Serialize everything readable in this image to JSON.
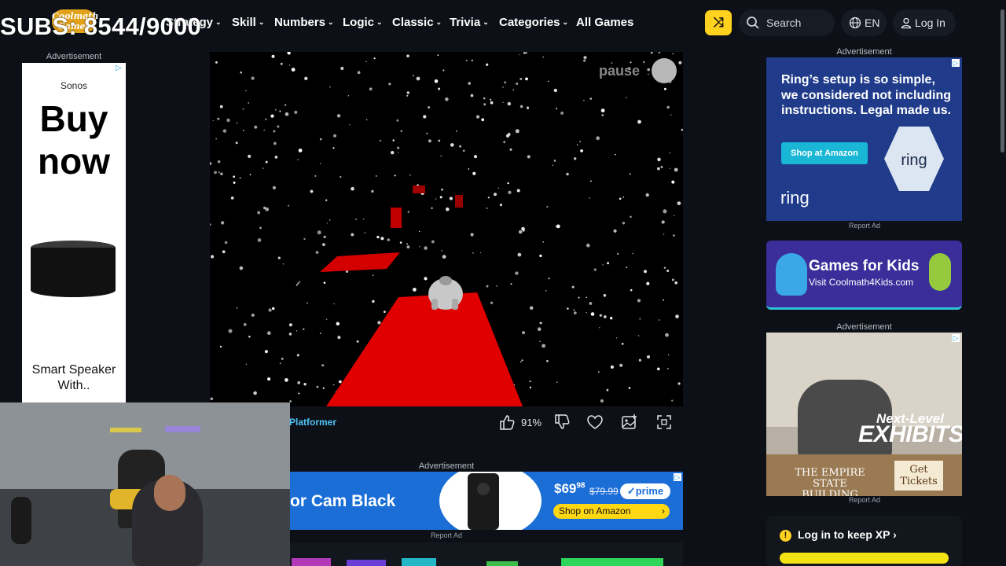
{
  "overlay": {
    "subs_counter": "SUBS: 8544/9000"
  },
  "header": {
    "logo_text": "Coolmath Games",
    "nav": [
      {
        "label": "Strategy",
        "has_dropdown": true
      },
      {
        "label": "Skill",
        "has_dropdown": true
      },
      {
        "label": "Numbers",
        "has_dropdown": true
      },
      {
        "label": "Logic",
        "has_dropdown": true
      },
      {
        "label": "Classic",
        "has_dropdown": true
      },
      {
        "label": "Trivia",
        "has_dropdown": true
      },
      {
        "label": "Categories",
        "has_dropdown": true
      },
      {
        "label": "All Games",
        "has_dropdown": false
      }
    ],
    "shuffle_icon": "shuffle-icon",
    "search_placeholder": "Search",
    "language": "EN",
    "login_label": "Log In"
  },
  "ads": {
    "label": "Advertisement",
    "report_label": "Report Ad",
    "left": {
      "brand": "Sonos",
      "headline": "Buy now",
      "product": "Smart Speaker With.."
    },
    "bottom": {
      "headline": "or Cam Black",
      "price_main": "$69",
      "price_cents": "98",
      "old_price": "$79.99",
      "prime_label": "✓prime",
      "cta": "Shop on Amazon"
    },
    "ring": {
      "text": "Ring’s setup is so simple, we considered not including instructions. Legal made us.",
      "cta": "Shop at Amazon",
      "logo": "ring",
      "badge": "ring"
    },
    "esb": {
      "tagline_top": "Next-Level",
      "tagline_main": "EXHIBITS",
      "brand": "THE EMPIRE STATE BUILDING",
      "cta": "Get Tickets"
    }
  },
  "game": {
    "pause_label": "pause",
    "category": "Platformer",
    "like_percent": "91%",
    "colors": {
      "track": "#e00000",
      "background": "#000000"
    }
  },
  "promo": {
    "title": "Games for Kids",
    "subtitle": "Visit Coolmath4Kids.com"
  },
  "xp": {
    "text": "Log in to keep XP",
    "arrow": "›",
    "warn_icon": "!"
  },
  "colors": {
    "accent_yellow": "#ffd21f",
    "link_blue": "#4fc3f7",
    "page_bg": "#0d1117"
  }
}
